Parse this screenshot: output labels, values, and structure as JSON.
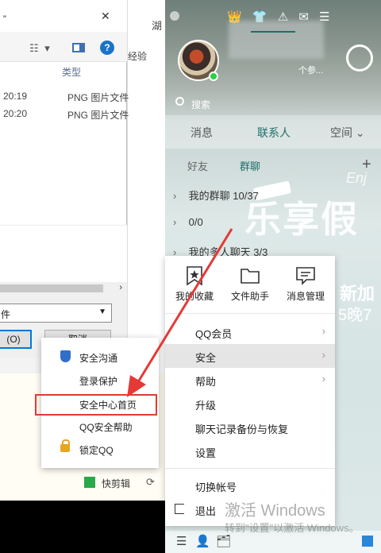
{
  "file_dialog": {
    "path_text": "\"",
    "close_glyph": "✕",
    "column_header": "类型",
    "rows": [
      {
        "time": "20:19",
        "type": "PNG 图片文件"
      },
      {
        "time": "20:20",
        "type": "PNG 图片文件"
      }
    ],
    "filetype_value": "件",
    "open_label": "(O)",
    "cancel_label": "取消"
  },
  "background": {
    "tab_label": "湖",
    "tab2_label": "经验",
    "editor_button": "快剪辑"
  },
  "qq": {
    "top_icons": [
      "👑",
      "👕",
      "⚠",
      "✉",
      "☰"
    ],
    "signature": "个参...",
    "search_placeholder": "搜索",
    "tabs": [
      "消息",
      "联系人",
      "空间"
    ],
    "sub_tabs": [
      "好友",
      "群聊"
    ],
    "groups": [
      {
        "label": "我的群聊",
        "count": "10/37"
      },
      {
        "label": "",
        "count": "0/0"
      },
      {
        "label": "我的多人聊天",
        "count": "3/3"
      }
    ],
    "ad_text": [
      "乐享假",
      "新加",
      "5晚7",
      "Enj"
    ],
    "bottom_icons": [
      "☰",
      "👤",
      "🗂"
    ]
  },
  "qq_menu": {
    "tools": [
      {
        "label": "我的收藏",
        "icon": "star-bookmark-icon"
      },
      {
        "label": "文件助手",
        "icon": "folder-icon"
      },
      {
        "label": "消息管理",
        "icon": "message-icon"
      }
    ],
    "items": [
      "QQ会员",
      "安全",
      "帮助",
      "升级",
      "聊天记录备份与恢复",
      "设置"
    ],
    "switch_account": "切换帐号",
    "exit": "退出"
  },
  "security_menu": {
    "items": [
      "安全沟通",
      "登录保护",
      "安全中心首页",
      "QQ安全帮助",
      "锁定QQ"
    ]
  },
  "watermark": {
    "line1": "激活 Windows",
    "line2": "转到\"设置\"以激活 Windows。"
  },
  "colors": {
    "accent": "#1c6f6a",
    "highlight_border": "#e53935",
    "menu_hover": "#e5e5e5"
  }
}
